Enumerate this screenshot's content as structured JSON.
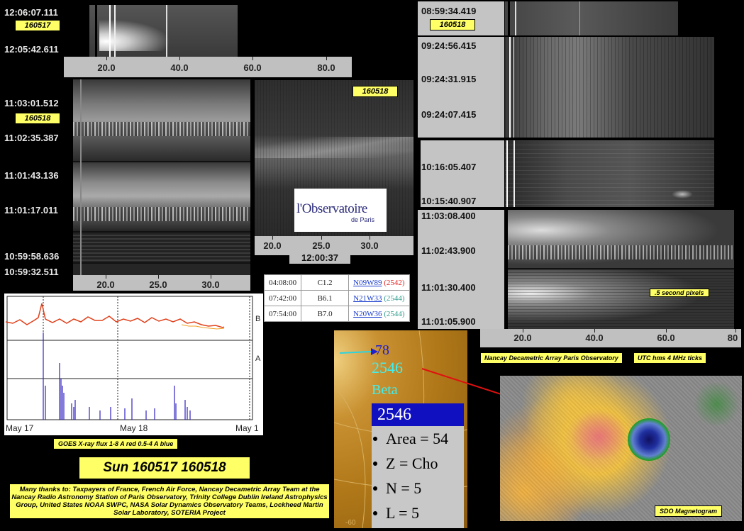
{
  "spectra_left": {
    "top": {
      "time_top": "12:06:07.111",
      "time_bottom": "12:05:42.611",
      "date": "160517",
      "axis_ticks": [
        "20.0",
        "40.0",
        "60.0",
        "80.0"
      ]
    },
    "main": {
      "date": "160518",
      "times": [
        "11:03:01.512",
        "11:02:35.387",
        "11:01:43.136",
        "11:01:17.011",
        "10:59:58.636",
        "10:59:32.511"
      ],
      "axis_ticks": [
        "20.0",
        "25.0",
        "30.0"
      ]
    }
  },
  "spectra_mid": {
    "date": "160518",
    "time": "12:00:37",
    "axis_ticks": [
      "20.0",
      "25.0",
      "30.0"
    ]
  },
  "logo": {
    "main": "l'Observatoire",
    "sub": "de Paris"
  },
  "spectra_right": {
    "date": "160518",
    "times": [
      "08:59:34.419",
      "09:24:56.415",
      "09:24:31.915",
      "09:24:07.415",
      "10:16:05.407",
      "10:15:40.907",
      "11:03:08.400",
      "11:02:43.900",
      "11:01:30.400",
      "11:01:05.900"
    ],
    "pixel_note": ".5 second pixels",
    "axis_ticks": [
      "20.0",
      "40.0",
      "60.0",
      "80"
    ],
    "credit": "Nancay Decametric Array Paris Observatory",
    "units": "UTC hms 4 MHz ticks"
  },
  "flares": {
    "rows": [
      {
        "time": "04:08:00",
        "class": "C1.2",
        "loc": "N09W89",
        "region": "2542"
      },
      {
        "time": "07:42:00",
        "class": "B6.1",
        "loc": "N21W33",
        "region": "2544"
      },
      {
        "time": "07:54:00",
        "class": "B7.0",
        "loc": "N20W36",
        "region": "2544"
      }
    ]
  },
  "goes": {
    "x_labels": [
      "May 17",
      "May 18",
      "May 1"
    ],
    "right_labels": [
      "B",
      "A"
    ],
    "caption": "GOES X-ray flux 1-8 A red 0.5-4 A blue",
    "colors": {
      "long": "#e0401a",
      "short": "#3020c0"
    }
  },
  "title": "Sun 160517 160518",
  "thanks": "Many thanks to: Taxpayers of France, French Air Force, Nancay Decametric Array Team at the Nancay Radio Astronomy Station of Paris Observatory, Trinity College Dublin Ireland Astrophysics Group, United States NOAA SWPC, NASA Solar Dynamics Observatory Teams, Lockheed Martin Solar Laboratory, SOTERIA Project",
  "region": {
    "arrow_label": "78",
    "region_id": "2546",
    "mag_class": "Beta",
    "box_title": "2546",
    "items": [
      "Area = 54",
      "Z = Cho",
      "N = 5",
      "L = 5"
    ],
    "bottom_edge": "-60"
  },
  "magnetogram": {
    "caption": "SDO Magnetogram"
  }
}
